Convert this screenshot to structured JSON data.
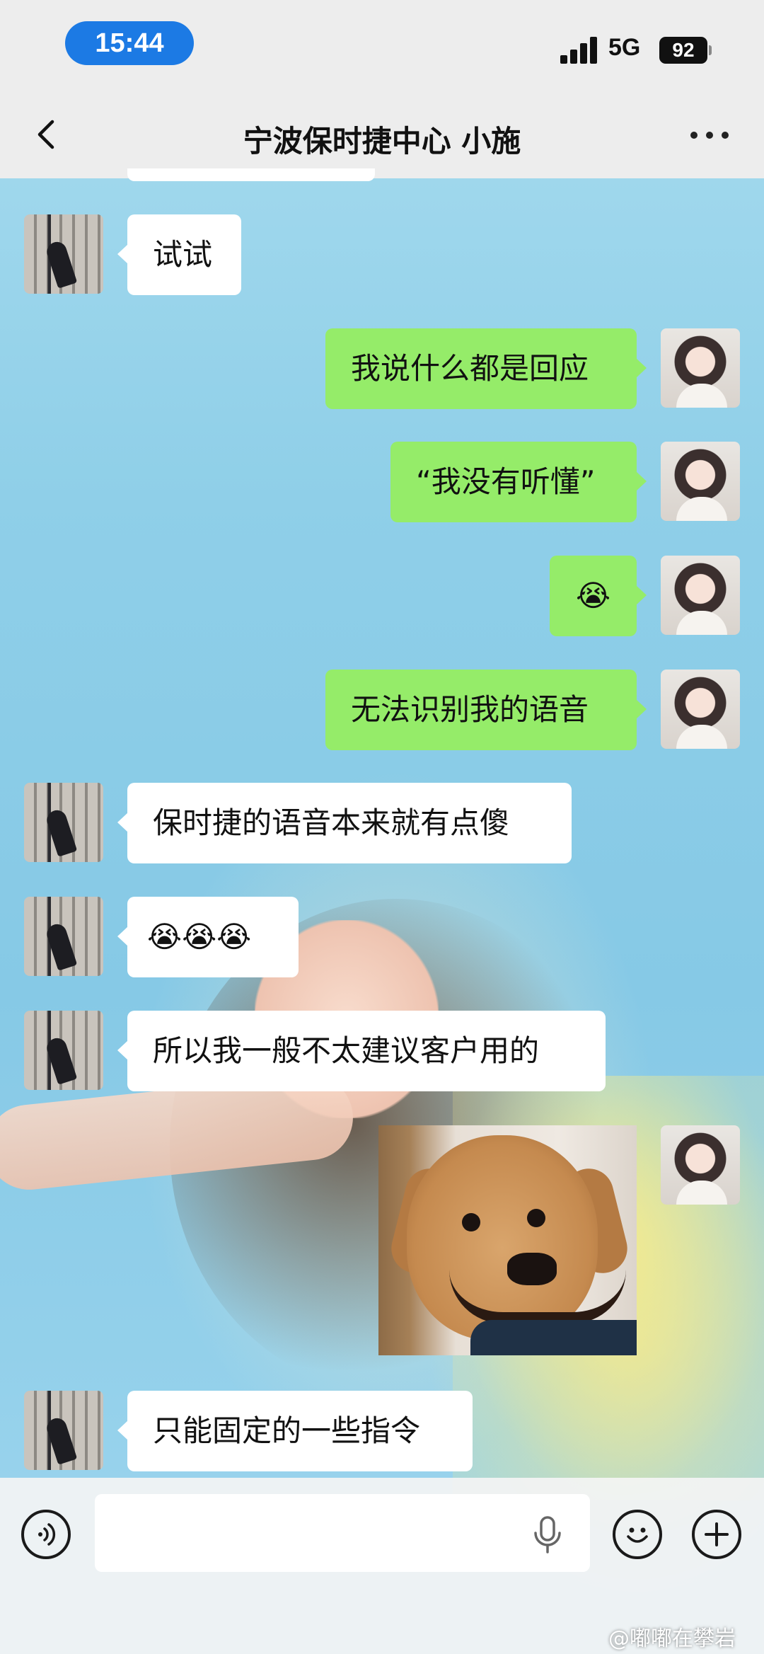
{
  "status_bar": {
    "time": "15:44",
    "network": "5G",
    "battery": "92"
  },
  "header": {
    "title": "宁波保时捷中心 小施"
  },
  "messages": [
    {
      "side": "left",
      "text": "试试"
    },
    {
      "side": "right",
      "text": "我说什么都是回应"
    },
    {
      "side": "right",
      "text": "“我没有听懂”"
    },
    {
      "side": "right",
      "text": "😭"
    },
    {
      "side": "right",
      "text": "无法识别我的语音"
    },
    {
      "side": "left",
      "text": "保时捷的语音本来就有点傻"
    },
    {
      "side": "left",
      "text": "😭😭😭"
    },
    {
      "side": "left",
      "text": "所以我一般不太建议客户用的"
    },
    {
      "side": "right",
      "type": "sticker",
      "sticker": "smiling-dog-sticker"
    },
    {
      "side": "left",
      "text": "只能固定的一些指令"
    }
  ],
  "input": {
    "value": ""
  },
  "watermark": "@嘟嘟在攀岩",
  "colors": {
    "sent_bubble": "#95ec69",
    "received_bubble": "#ffffff",
    "time_pill": "#1c7ae4"
  }
}
